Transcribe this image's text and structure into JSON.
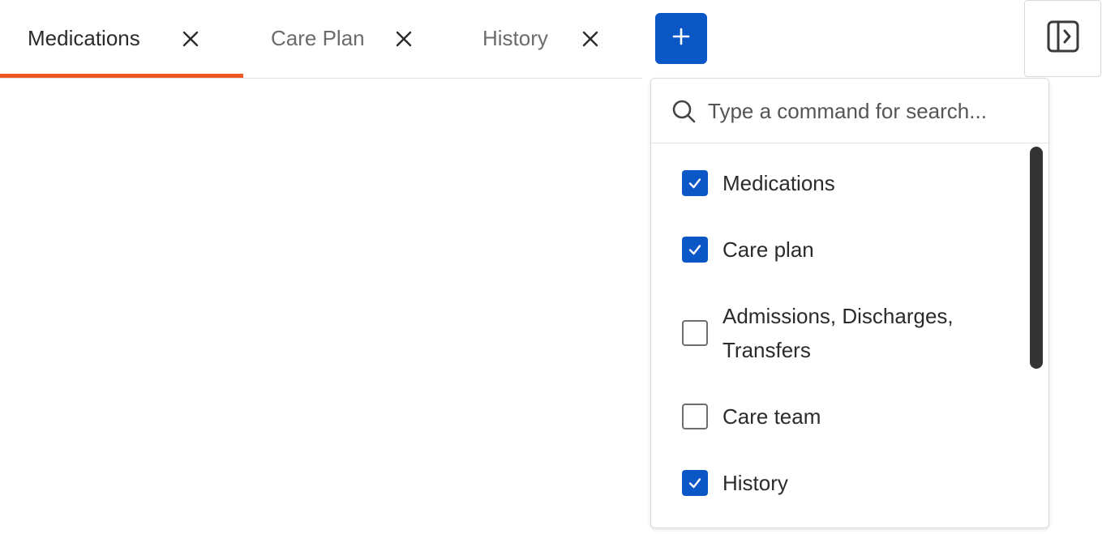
{
  "tabs": [
    {
      "label": "Medications",
      "active": true,
      "close_icon": "close-icon"
    },
    {
      "label": "Care Plan",
      "active": false,
      "close_icon": "close-icon"
    },
    {
      "label": "History",
      "active": false,
      "close_icon": "close-icon"
    }
  ],
  "add_button": {
    "icon": "plus-icon"
  },
  "panel_toggle": {
    "icon": "panel-expand-icon"
  },
  "dropdown": {
    "search": {
      "icon": "search-icon",
      "placeholder": "Type a command for search...",
      "value": ""
    },
    "options": [
      {
        "label": "Medications",
        "checked": true
      },
      {
        "label": "Care plan",
        "checked": true
      },
      {
        "label": "Admissions, Discharges, Transfers",
        "checked": false
      },
      {
        "label": "Care team",
        "checked": false
      },
      {
        "label": "History",
        "checked": true
      }
    ]
  },
  "colors": {
    "accent": "#0b57c6",
    "active_tab_underline": "#f05a22",
    "text": "#2b2b2b",
    "muted_text": "#6b6b6b"
  }
}
